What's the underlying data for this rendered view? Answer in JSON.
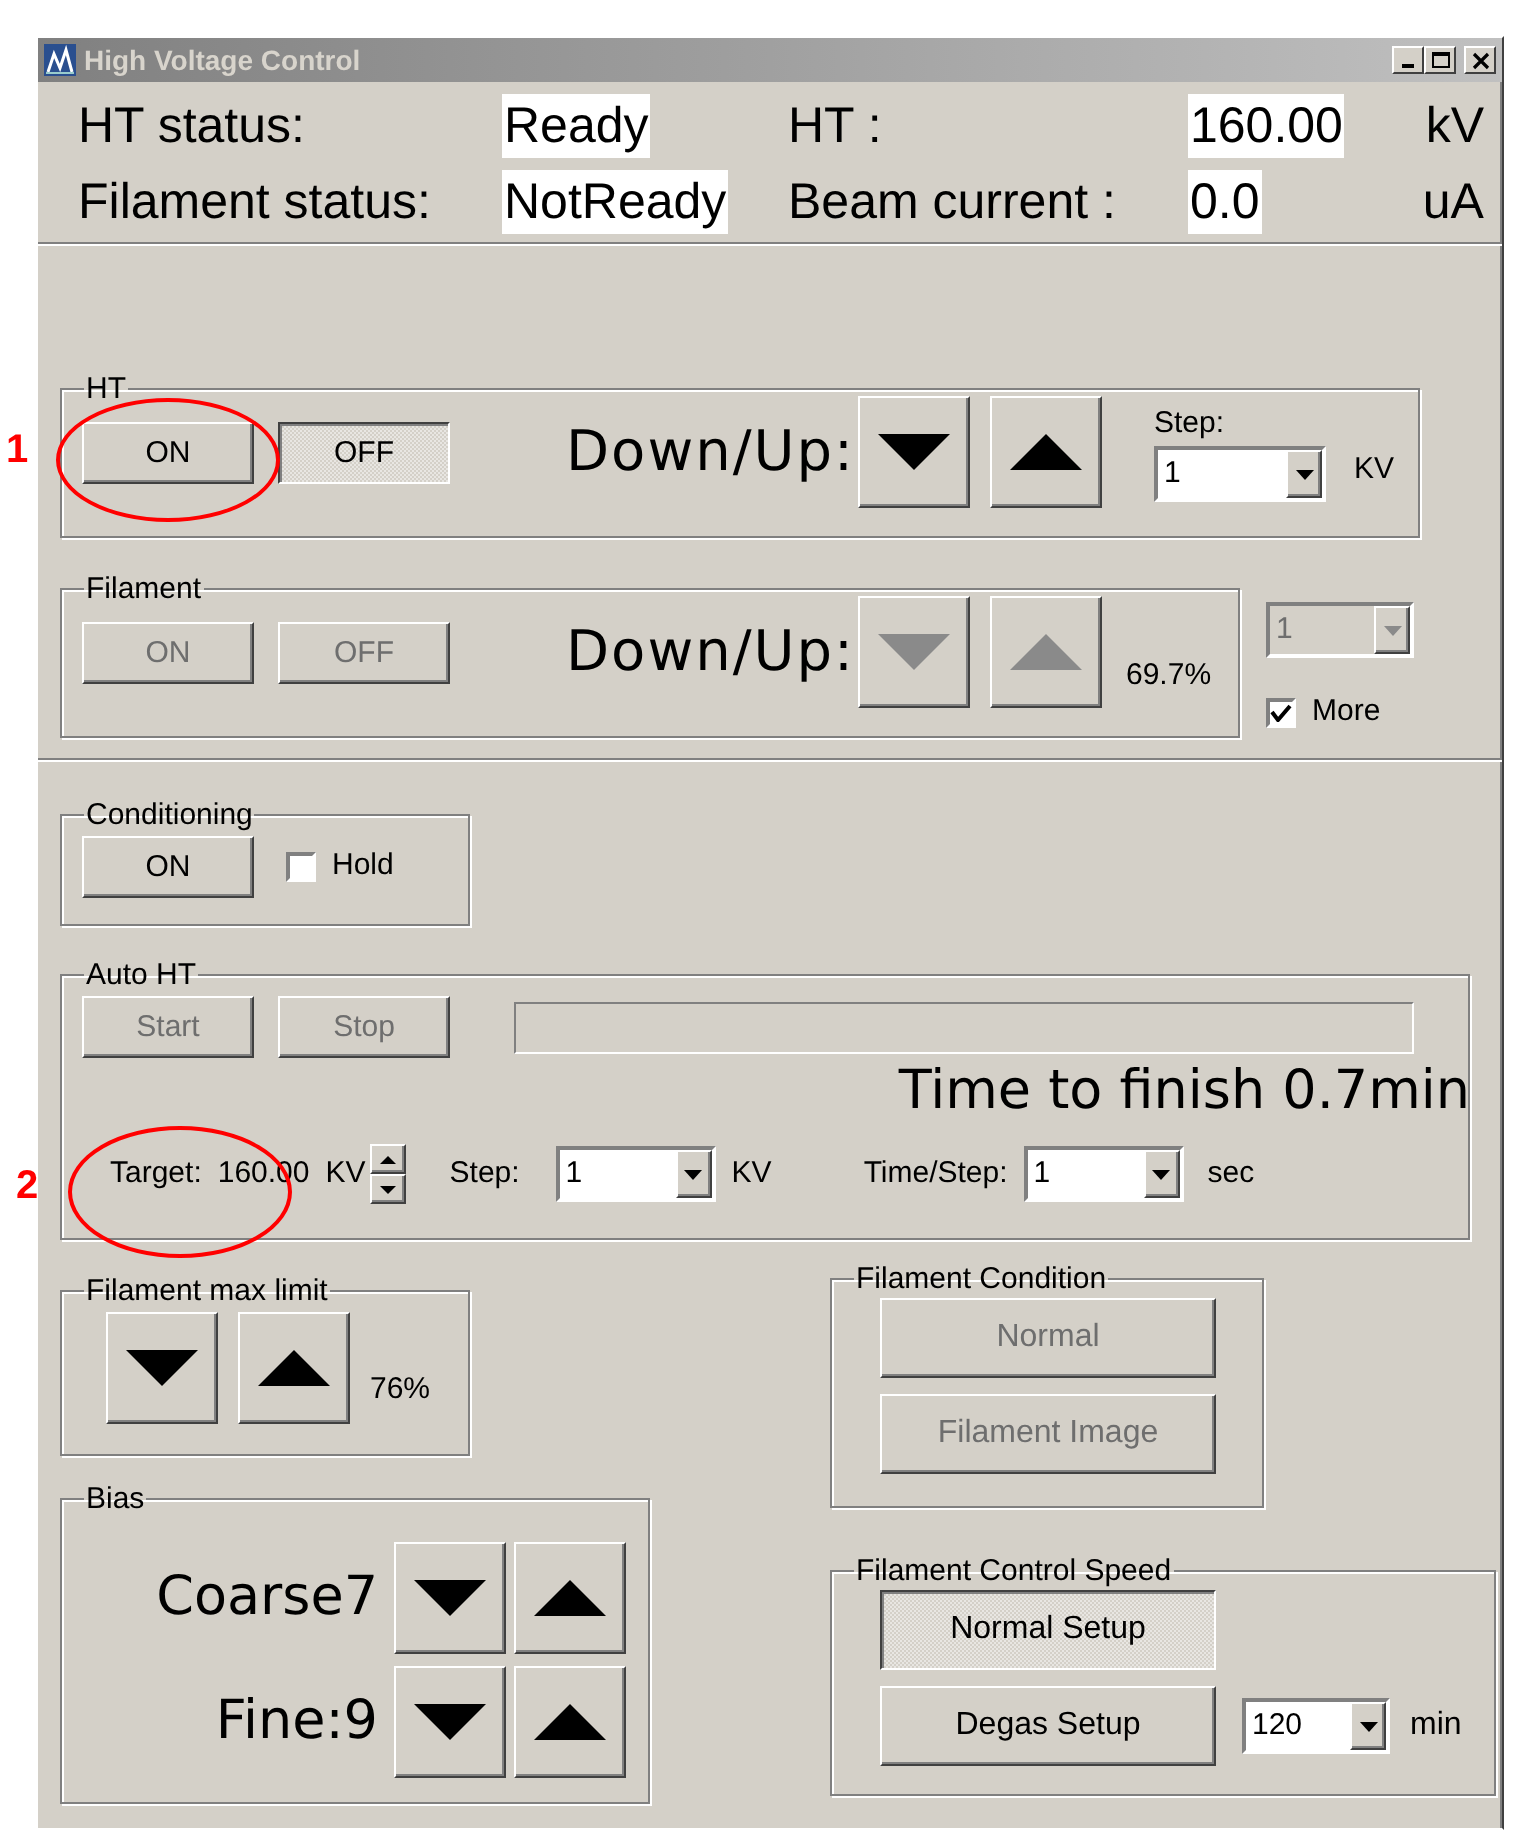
{
  "window": {
    "title": "High Voltage Control"
  },
  "status": {
    "rows": [
      {
        "label": "HT status:",
        "value": "Ready",
        "label2": "HT :",
        "value2": "160.00",
        "unit": "kV"
      },
      {
        "label": "Filament status:",
        "value": "NotReady",
        "label2": "Beam current :",
        "value2": "0.0",
        "unit": "uA"
      }
    ]
  },
  "ht": {
    "title": "HT",
    "buttons": [
      {
        "label": "ON",
        "pressed": false,
        "disabled": false
      },
      {
        "label": "OFF",
        "pressed": true,
        "disabled": false
      }
    ],
    "down_up": "Down/Up:",
    "arrows_disabled": false,
    "step": {
      "label": "Step:",
      "value": "1",
      "unit": "KV",
      "disabled": false
    }
  },
  "filament": {
    "title": "Filament",
    "buttons": [
      {
        "label": "ON",
        "pressed": false,
        "disabled": true
      },
      {
        "label": "OFF",
        "pressed": false,
        "disabled": true
      }
    ],
    "down_up": "Down/Up:",
    "arrows_disabled": true,
    "reading": "69.7%",
    "side_select": {
      "value": "1",
      "disabled": true
    },
    "more": {
      "label": "More",
      "checked": true
    }
  },
  "conditioning": {
    "title": "Conditioning",
    "button": {
      "label": "ON",
      "pressed": false,
      "disabled": false
    },
    "hold": {
      "label": "Hold",
      "checked": false
    }
  },
  "auto_ht": {
    "title": "Auto HT",
    "buttons": [
      {
        "label": "Start",
        "pressed": false,
        "disabled": true
      },
      {
        "label": "Stop",
        "pressed": false,
        "disabled": true
      }
    ],
    "progress": {
      "level": 0
    },
    "time_to_finish": "Time to finish 0.7min",
    "target": {
      "label": "Target:",
      "value": "160.00",
      "unit": "KV"
    },
    "step": {
      "label": "Step:",
      "value": "1",
      "unit": "KV",
      "disabled": false
    },
    "time_step": {
      "label": "Time/Step:",
      "value": "1",
      "unit": "sec",
      "disabled": false
    }
  },
  "filament_max_limit": {
    "title": "Filament max limit",
    "arrows_disabled": false,
    "reading": "76%"
  },
  "bias": {
    "title": "Bias",
    "rows": [
      {
        "label": "Coarse7",
        "arrows_disabled": false
      },
      {
        "label": "Fine:9",
        "arrows_disabled": false
      }
    ]
  },
  "filament_condition": {
    "title": "Filament Condition",
    "buttons": [
      {
        "label": "Normal",
        "pressed": false,
        "disabled": true
      },
      {
        "label": "Filament Image",
        "pressed": false,
        "disabled": true
      }
    ]
  },
  "filament_control_speed": {
    "title": "Filament Control Speed",
    "buttons": [
      {
        "label": "Normal Setup",
        "pressed": true,
        "disabled": false
      },
      {
        "label": "Degas Setup",
        "pressed": false,
        "disabled": false
      }
    ],
    "duration": {
      "value": "120",
      "unit": "min",
      "disabled": false
    }
  },
  "annotations": [
    {
      "label": "1"
    },
    {
      "label": "2"
    }
  ]
}
